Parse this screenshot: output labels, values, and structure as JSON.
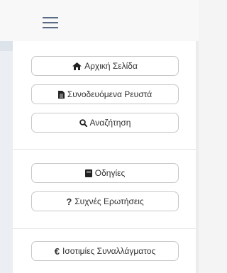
{
  "header": {
    "menu_icon": "hamburger-icon"
  },
  "menu": {
    "group1": [
      {
        "label": "Αρχική Σελίδα",
        "icon": "home-icon"
      },
      {
        "label": "Συνοδευόμενα Ρευστά",
        "icon": "file-icon"
      },
      {
        "label": "Αναζήτηση",
        "icon": "search-icon"
      }
    ],
    "group2": [
      {
        "label": "Οδηγίες",
        "icon": "book-icon"
      },
      {
        "label": "Συχνές Ερωτήσεις",
        "icon": "question-icon",
        "glyph": "?"
      }
    ],
    "group3": [
      {
        "label": "Ισοτιμίες Συναλλάγματος",
        "icon": "euro-icon",
        "glyph": "€"
      }
    ]
  }
}
